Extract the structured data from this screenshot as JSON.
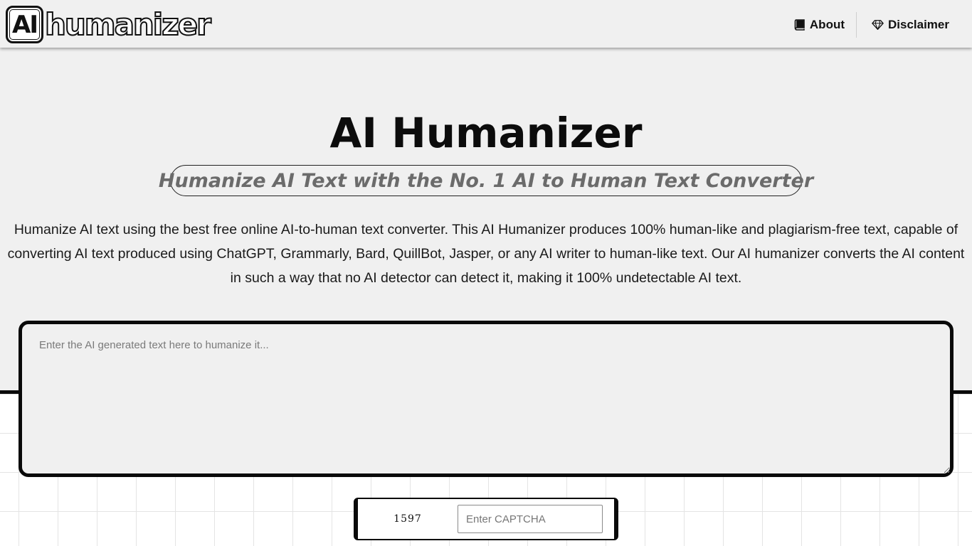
{
  "header": {
    "logo_mark": "AI",
    "logo_word": "humanizer",
    "nav": {
      "about_label": "About",
      "disclaimer_label": "Disclaimer",
      "about_icon": "book-icon",
      "disclaimer_icon": "diamond-icon"
    }
  },
  "hero": {
    "title": "AI Humanizer",
    "subtitle": "Humanize AI Text with the No. 1 AI to Human Text Converter",
    "intro": "Humanize AI text using the best free online AI-to-human text converter. This AI Humanizer produces 100% human-like and plagiarism-free text, capable of converting AI text produced using ChatGPT, Grammarly, Bard, QuillBot, Jasper, or any AI writer to human-like text. Our AI humanizer converts the AI content in such a way that no AI detector can detect it, making it 100% undetectable AI text."
  },
  "editor": {
    "value": "",
    "placeholder": "Enter the AI generated text here to humanize it..."
  },
  "captcha": {
    "code": "1597",
    "value": "",
    "placeholder": "Enter CAPTCHA"
  },
  "colors": {
    "background": "#f0f0f0",
    "border": "#0a0a0a",
    "subtitle_text": "#6b6b6b"
  }
}
